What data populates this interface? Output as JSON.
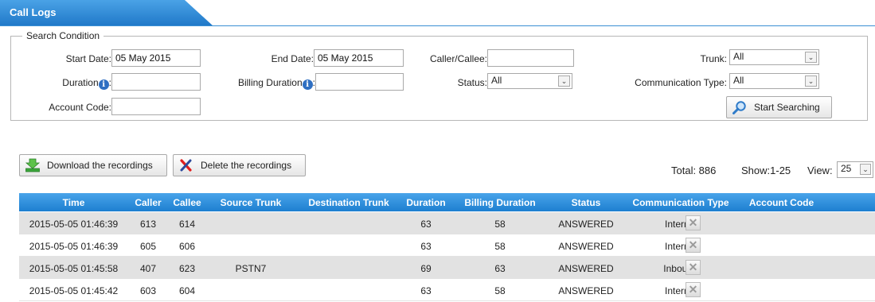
{
  "tab": {
    "title": "Call Logs"
  },
  "search": {
    "legend": "Search Condition",
    "start_date_label": "Start Date:",
    "start_date_value": "05 May 2015",
    "end_date_label": "End Date:",
    "end_date_value": "05 May 2015",
    "caller_label": "Caller/Callee:",
    "caller_value": "",
    "trunk_label": "Trunk:",
    "trunk_value": "All",
    "duration_label": "Duration",
    "duration_value": "",
    "billing_label": "Billing Duration",
    "billing_value": "",
    "status_label": "Status:",
    "status_value": "All",
    "comm_type_label": "Communication Type:",
    "comm_type_value": "All",
    "account_label": "Account Code:",
    "account_value": "",
    "search_button": "Start Searching",
    "colon": ":"
  },
  "toolbar": {
    "download_label": "Download the recordings",
    "delete_label": "Delete the recordings"
  },
  "summary": {
    "total": "Total: 886",
    "show": "Show:1-25",
    "view_label": "View:",
    "view_value": "25"
  },
  "table": {
    "headers": [
      "Time",
      "Caller",
      "Callee",
      "Source Trunk",
      "Destination Trunk",
      "Duration",
      "Billing Duration",
      "Status",
      "Communication Type",
      "Account Code"
    ],
    "rows": [
      [
        "2015-05-05 01:46:39",
        "613",
        "614",
        "",
        "",
        "63",
        "58",
        "ANSWERED",
        "Internal",
        ""
      ],
      [
        "2015-05-05 01:46:39",
        "605",
        "606",
        "",
        "",
        "63",
        "58",
        "ANSWERED",
        "Internal",
        ""
      ],
      [
        "2015-05-05 01:45:58",
        "407",
        "623",
        "PSTN7",
        "",
        "69",
        "63",
        "ANSWERED",
        "Inbound",
        ""
      ],
      [
        "2015-05-05 01:45:42",
        "603",
        "604",
        "",
        "",
        "63",
        "58",
        "ANSWERED",
        "Internal",
        ""
      ]
    ]
  },
  "icons": {
    "download": "download-arrow-icon",
    "delete": "red-x-icon",
    "search": "magnifier-icon",
    "info": "info-icon",
    "row_delete": "delete-x-icon"
  },
  "colors": {
    "header_blue": "#1d7fd0",
    "row_alt": "#e2e2e2"
  }
}
